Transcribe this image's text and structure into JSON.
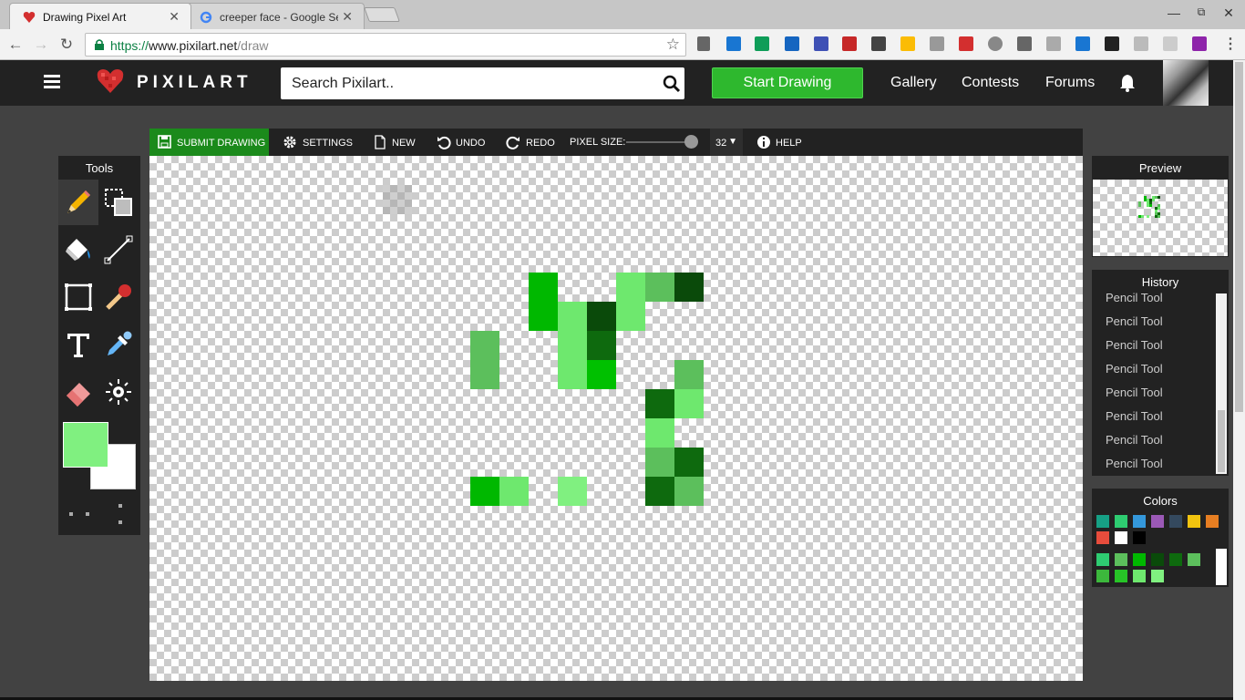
{
  "browser": {
    "tabs": [
      {
        "title": "Drawing Pixel Art"
      },
      {
        "title": "creeper face - Google Sea"
      }
    ],
    "url": {
      "scheme": "https://",
      "host": "www.pixilart.net",
      "path": "/draw"
    }
  },
  "header": {
    "logo_text": "PIXILART",
    "search_placeholder": "Search Pixilart..",
    "start_label": "Start Drawing",
    "nav": [
      "Gallery",
      "Contests",
      "Forums"
    ]
  },
  "toolbar": {
    "submit_label": "SUBMIT DRAWING",
    "settings_label": "SETTINGS",
    "new_label": "NEW",
    "undo_label": "UNDO",
    "redo_label": "REDO",
    "pixel_size_label": "PIXEL SIZE:",
    "pixel_size_value": "32",
    "help_label": "HELP"
  },
  "tools": {
    "title": "Tools",
    "items": [
      "pencil",
      "selection",
      "fill-bucket",
      "line",
      "rectangle",
      "match",
      "text",
      "color-picker",
      "eraser",
      "lighten-darken"
    ],
    "selected": "pencil",
    "primary_color": "#80f080",
    "secondary_color": "#ffffff"
  },
  "canvas": {
    "pixel_size": 32,
    "cursor_hover": {
      "col": 8,
      "row": 1,
      "color": "#a0a0a0"
    },
    "pixels": [
      {
        "col": 13,
        "row": 4,
        "color": "#00b800"
      },
      {
        "col": 16,
        "row": 4,
        "color": "#6ee86e"
      },
      {
        "col": 17,
        "row": 4,
        "color": "#5cbf5c"
      },
      {
        "col": 18,
        "row": 4,
        "color": "#0a4a0a"
      },
      {
        "col": 13,
        "row": 5,
        "color": "#00b800"
      },
      {
        "col": 14,
        "row": 5,
        "color": "#6ee86e"
      },
      {
        "col": 15,
        "row": 5,
        "color": "#0a4a0a"
      },
      {
        "col": 16,
        "row": 5,
        "color": "#6ee86e"
      },
      {
        "col": 11,
        "row": 6,
        "color": "#5cbf5c"
      },
      {
        "col": 14,
        "row": 6,
        "color": "#6ee86e"
      },
      {
        "col": 15,
        "row": 6,
        "color": "#0e6a0e"
      },
      {
        "col": 11,
        "row": 7,
        "color": "#5cbf5c"
      },
      {
        "col": 14,
        "row": 7,
        "color": "#6ee86e"
      },
      {
        "col": 15,
        "row": 7,
        "color": "#00c000"
      },
      {
        "col": 18,
        "row": 7,
        "color": "#5cbf5c"
      },
      {
        "col": 17,
        "row": 8,
        "color": "#0e6a0e"
      },
      {
        "col": 18,
        "row": 8,
        "color": "#6ee86e"
      },
      {
        "col": 17,
        "row": 9,
        "color": "#6ee86e"
      },
      {
        "col": 17,
        "row": 10,
        "color": "#5cbf5c"
      },
      {
        "col": 18,
        "row": 10,
        "color": "#0e6a0e"
      },
      {
        "col": 11,
        "row": 11,
        "color": "#00b800"
      },
      {
        "col": 12,
        "row": 11,
        "color": "#6ee86e"
      },
      {
        "col": 14,
        "row": 11,
        "color": "#80f080"
      },
      {
        "col": 17,
        "row": 11,
        "color": "#0e6a0e"
      },
      {
        "col": 18,
        "row": 11,
        "color": "#5cbf5c"
      }
    ]
  },
  "preview": {
    "title": "Preview"
  },
  "history": {
    "title": "History",
    "items": [
      "Pencil Tool",
      "Pencil Tool",
      "Pencil Tool",
      "Pencil Tool",
      "Pencil Tool",
      "Pencil Tool",
      "Pencil Tool",
      "Pencil Tool"
    ]
  },
  "colors": {
    "title": "Colors",
    "palette": [
      "#16a085",
      "#2ecc71",
      "#3498db",
      "#9b59b6",
      "#34495e",
      "#f1c40f",
      "#e67e22",
      "#e74c3c",
      "#ffffff",
      "#000000"
    ],
    "custom": [
      "#2ecc71",
      "#5cbf5c",
      "#00b800",
      "#0a4a0a",
      "#0e6a0e",
      "#5cbf5c",
      "#3cb83c",
      "#27c427",
      "#6ee86e",
      "#80f080"
    ]
  }
}
